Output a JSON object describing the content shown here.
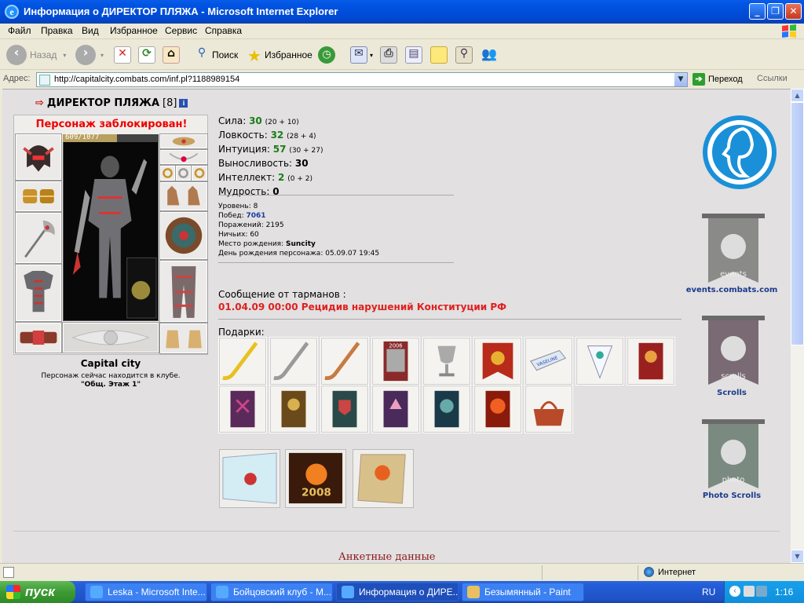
{
  "window": {
    "title": "Информация о ДИРЕКТОР ПЛЯЖА - Microsoft Internet Explorer"
  },
  "menu": [
    "Файл",
    "Правка",
    "Вид",
    "Избранное",
    "Сервис",
    "Справка"
  ],
  "toolbar": {
    "back": "Назад",
    "search": "Поиск",
    "favorites": "Избранное"
  },
  "address": {
    "label": "Адрес:",
    "url": "http://capitalcity.combats.com/inf.pl?1188989154",
    "go": "Переход",
    "links": "Ссылки"
  },
  "character": {
    "name": "ДИРЕКТОР ПЛЯЖА",
    "level_badge": "[8]",
    "blocked": "Персонаж заблокирован!",
    "hp": "609/1077",
    "hp_fraction": 0.565,
    "city": "Capital city",
    "location_line": "Персонаж сейчас находится в клубе.",
    "location_place": "\"Общ. Этаж 1\""
  },
  "stats": [
    {
      "label": "Сила:",
      "value": "30",
      "detail": "(20 + 10)"
    },
    {
      "label": "Ловкость:",
      "value": "32",
      "detail": "(28 + 4)"
    },
    {
      "label": "Интуиция:",
      "value": "57",
      "detail": "(30 + 27)"
    },
    {
      "label": "Выносливость:",
      "value": "30",
      "detail": ""
    },
    {
      "label": "Интеллект:",
      "value": "2",
      "detail": "(0 + 2)"
    },
    {
      "label": "Мудрость:",
      "value": "0",
      "detail": ""
    }
  ],
  "meta": {
    "level_label": "Уровень:",
    "level": "8",
    "wins_label": "Побед:",
    "wins": "7061",
    "losses_label": "Поражений:",
    "losses": "2195",
    "draws_label": "Ничьих:",
    "draws": "60",
    "birthplace_label": "Место рождения:",
    "birthplace": "Suncity",
    "birthday_label": "День рождения персонажа:",
    "birthday": "05.09.07 19:45"
  },
  "message": {
    "heading": "Сообщение от тарманов :",
    "text": "01.04.09 00:00 Рецидив нарушений Конституции РФ"
  },
  "gifts": {
    "heading": "Подарки:"
  },
  "side": {
    "events": "events.combats.com",
    "scrolls": "Scrolls",
    "photo": "Photo Scrolls",
    "flag_events": "events",
    "flag_scrolls": "scrolls",
    "flag_photo": "photo"
  },
  "profile_heading": "Анкетные данные",
  "status": {
    "zone": "Интернет"
  },
  "taskbar": {
    "start": "пуск",
    "tasks": [
      "Leska - Microsoft Inte...",
      "Бойцовский клуб - М...",
      "Информация о ДИРЕ...",
      "Безымянный - Paint"
    ],
    "lang": "RU",
    "clock": "1:16"
  },
  "colors": {
    "stat_green": "#1a7c1a",
    "blocked_red": "#e00000",
    "message_red": "#e02020",
    "xp_blue": "#0054e3"
  }
}
